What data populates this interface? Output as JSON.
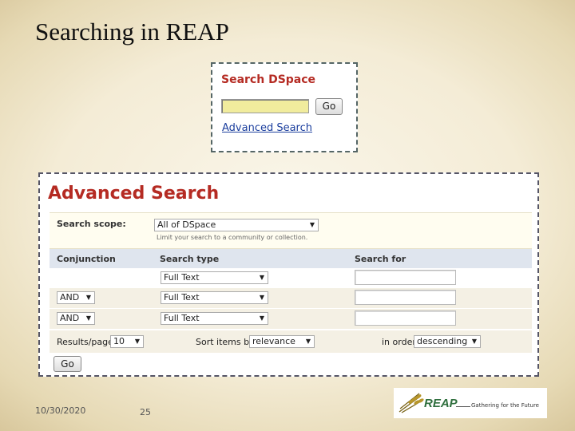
{
  "slide": {
    "title": "Searching in REAP",
    "date": "10/30/2020",
    "page_number": "25"
  },
  "simple_search": {
    "title": "Search DSpace",
    "input_value": "",
    "go_label": "Go",
    "advanced_link": "Advanced Search"
  },
  "advanced": {
    "title": "Advanced Search",
    "scope_label": "Search scope:",
    "scope_value": "All of DSpace",
    "scope_hint": "Limit your search to a community or collection.",
    "headers": {
      "conjunction": "Conjunction",
      "search_type": "Search type",
      "search_for": "Search for"
    },
    "rows": [
      {
        "conjunction": "",
        "search_type": "Full Text",
        "search_for": ""
      },
      {
        "conjunction": "AND",
        "search_type": "Full Text",
        "search_for": ""
      },
      {
        "conjunction": "AND",
        "search_type": "Full Text",
        "search_for": ""
      }
    ],
    "results_label": "Results/page",
    "results_value": "10",
    "sort_label": "Sort items by",
    "sort_value": "relevance",
    "order_label": "in order",
    "order_value": "descending",
    "go_label": "Go"
  },
  "logo": {
    "name": "REAP",
    "tagline": "Gathering for the Future"
  },
  "colors": {
    "accent_red": "#b52b23",
    "link_blue": "#1c3f9e",
    "input_yellow": "#f1ec9d",
    "header_blue": "#dfe5ee"
  }
}
